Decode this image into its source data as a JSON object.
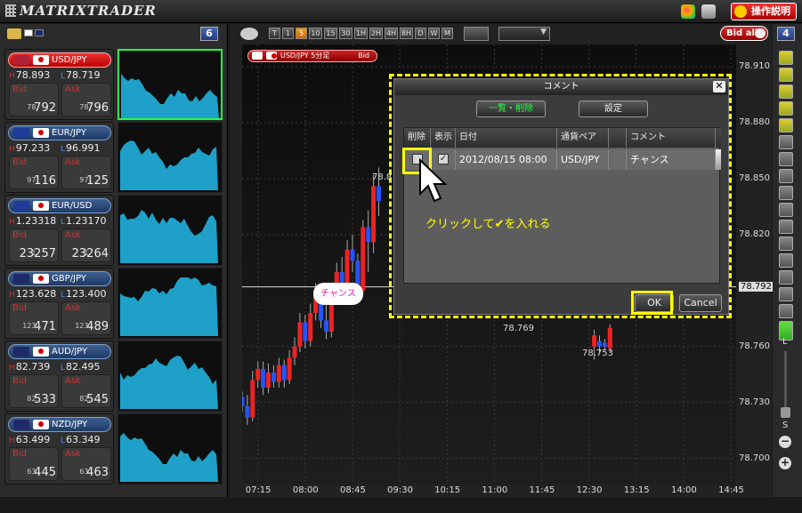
{
  "app": {
    "logo_text": "MATRIXTRADER",
    "help_button": "操作説明"
  },
  "left_panel": {
    "pair_count": "6",
    "pairs": [
      {
        "name": "USD/JPY",
        "high": "78.893",
        "low": "78.719",
        "bid_small": "78.",
        "bid_big": "792",
        "ask_small": "78.",
        "ask_big": "796",
        "flag_color": "#b22234",
        "active": true
      },
      {
        "name": "EUR/JPY",
        "high": "97.233",
        "low": "96.991",
        "bid_small": "97.",
        "bid_big": "116",
        "ask_small": "97.",
        "ask_big": "125",
        "flag_color": "#1f3c9a",
        "active": false
      },
      {
        "name": "EUR/USD",
        "high": "1.23318",
        "low": "1.23170",
        "bid_small": "1.",
        "bid_big": "23257",
        "ask_small": "1.",
        "ask_big": "23264",
        "flag_color": "#1f3c9a",
        "active": false
      },
      {
        "name": "GBP/JPY",
        "high": "123.628",
        "low": "123.400",
        "bid_small": "123.",
        "bid_big": "471",
        "ask_small": "123.",
        "ask_big": "489",
        "flag_color": "#1f2a6a",
        "active": false
      },
      {
        "name": "AUD/JPY",
        "high": "82.739",
        "low": "82.495",
        "bid_small": "82.",
        "bid_big": "533",
        "ask_small": "82.",
        "ask_big": "545",
        "flag_color": "#1f2a6a",
        "active": false
      },
      {
        "name": "NZD/JPY",
        "high": "63.499",
        "low": "63.349",
        "bid_small": "63.",
        "bid_big": "445",
        "ask_small": "63.",
        "ask_big": "463",
        "flag_color": "#1f2a6a",
        "active": false
      }
    ],
    "labels": {
      "high": "H",
      "low": "L",
      "bid": "Bid",
      "ask": "Ask"
    }
  },
  "chart": {
    "timeframes": [
      "T",
      "1",
      "5",
      "10",
      "15",
      "30",
      "1H",
      "2H",
      "4H",
      "8H",
      "D",
      "W",
      "M"
    ],
    "selected_timeframe": "5",
    "bid_all": "Bid all",
    "chart_count": "4",
    "symbol_tag": "USD/JPY 5分足",
    "symbol_tag_side": "Bid",
    "y_ticks": [
      "78.910",
      "78.880",
      "78.850",
      "78.820",
      "78.792",
      "78.760",
      "78.730",
      "78.700"
    ],
    "x_ticks": [
      "07:15",
      "08:00",
      "08:45",
      "09:30",
      "10:15",
      "11:00",
      "11:45",
      "12:30",
      "13:15",
      "14:00",
      "14:45"
    ],
    "labels": {
      "high_marker": "78.8",
      "mid_marker": "78.769",
      "low_marker": "78.753"
    },
    "chance_balloon": "チャンス",
    "zoom_large": "L",
    "zoom_small": "S",
    "candles": [
      {
        "t": "07:00",
        "o": 78.733,
        "c": 78.728,
        "h": 78.736,
        "l": 78.725
      },
      {
        "t": "07:05",
        "o": 78.728,
        "c": 78.722,
        "h": 78.734,
        "l": 78.718
      },
      {
        "t": "07:10",
        "o": 78.722,
        "c": 78.742,
        "h": 78.747,
        "l": 78.72
      },
      {
        "t": "07:15",
        "o": 78.742,
        "c": 78.748,
        "h": 78.752,
        "l": 78.738
      },
      {
        "t": "07:20",
        "o": 78.748,
        "c": 78.738,
        "h": 78.752,
        "l": 78.734
      },
      {
        "t": "07:25",
        "o": 78.738,
        "c": 78.746,
        "h": 78.751,
        "l": 78.735
      },
      {
        "t": "07:30",
        "o": 78.746,
        "c": 78.741,
        "h": 78.75,
        "l": 78.738
      },
      {
        "t": "07:35",
        "o": 78.741,
        "c": 78.75,
        "h": 78.754,
        "l": 78.738
      },
      {
        "t": "07:40",
        "o": 78.75,
        "c": 78.742,
        "h": 78.753,
        "l": 78.738
      },
      {
        "t": "07:45",
        "o": 78.742,
        "c": 78.754,
        "h": 78.758,
        "l": 78.74
      },
      {
        "t": "07:50",
        "o": 78.754,
        "c": 78.76,
        "h": 78.765,
        "l": 78.75
      },
      {
        "t": "07:55",
        "o": 78.76,
        "c": 78.773,
        "h": 78.778,
        "l": 78.757
      },
      {
        "t": "08:00",
        "o": 78.773,
        "c": 78.763,
        "h": 78.777,
        "l": 78.759
      },
      {
        "t": "08:05",
        "o": 78.763,
        "c": 78.778,
        "h": 78.783,
        "l": 78.76
      },
      {
        "t": "08:10",
        "o": 78.778,
        "c": 78.79,
        "h": 78.794,
        "l": 78.774
      },
      {
        "t": "08:15",
        "o": 78.79,
        "c": 78.774,
        "h": 78.793,
        "l": 78.77
      },
      {
        "t": "08:20",
        "o": 78.774,
        "c": 78.768,
        "h": 78.79,
        "l": 78.764
      },
      {
        "t": "08:25",
        "o": 78.768,
        "c": 78.79,
        "h": 78.794,
        "l": 78.765
      },
      {
        "t": "08:30",
        "o": 78.79,
        "c": 78.8,
        "h": 78.805,
        "l": 78.785
      },
      {
        "t": "08:35",
        "o": 78.8,
        "c": 78.794,
        "h": 78.808,
        "l": 78.789
      },
      {
        "t": "08:40",
        "o": 78.794,
        "c": 78.812,
        "h": 78.817,
        "l": 78.79
      },
      {
        "t": "08:45",
        "o": 78.812,
        "c": 78.806,
        "h": 78.82,
        "l": 78.8
      },
      {
        "t": "08:50",
        "o": 78.806,
        "c": 78.79,
        "h": 78.81,
        "l": 78.785
      },
      {
        "t": "08:55",
        "o": 78.79,
        "c": 78.824,
        "h": 78.828,
        "l": 78.788
      },
      {
        "t": "09:00",
        "o": 78.824,
        "c": 78.816,
        "h": 78.833,
        "l": 78.8
      },
      {
        "t": "09:05",
        "o": 78.816,
        "c": 78.846,
        "h": 78.852,
        "l": 78.81
      },
      {
        "t": "09:10",
        "o": 78.846,
        "c": 78.838,
        "h": 78.856,
        "l": 78.83
      }
    ],
    "tail_candles": [
      {
        "t": "12:35",
        "o": 78.76,
        "c": 78.766,
        "h": 78.769,
        "l": 78.753
      },
      {
        "t": "12:40",
        "o": 78.763,
        "c": 78.76,
        "h": 78.766,
        "l": 78.757
      },
      {
        "t": "12:45",
        "o": 78.762,
        "c": 78.76,
        "h": 78.764,
        "l": 78.758
      },
      {
        "t": "12:50",
        "o": 78.759,
        "c": 78.77,
        "h": 78.772,
        "l": 78.757
      }
    ],
    "price_min": 78.686,
    "price_max": 78.922,
    "last_price_row": 78.792
  },
  "dialog": {
    "title": "コメント",
    "list_delete_button": "一覧・削除",
    "settings_button": "設定",
    "columns": [
      "削除",
      "表示",
      "日付",
      "通貨ペア",
      "",
      "コメント"
    ],
    "rows": [
      {
        "delete": false,
        "display": true,
        "date": "2012/08/15 08:00",
        "pair": "USD/JPY",
        "comment": "チャンス"
      }
    ],
    "ok_button": "OK",
    "cancel_button": "Cancel",
    "close_glyph": "✕"
  },
  "annotation": {
    "note": "クリックして✔を入れる"
  }
}
